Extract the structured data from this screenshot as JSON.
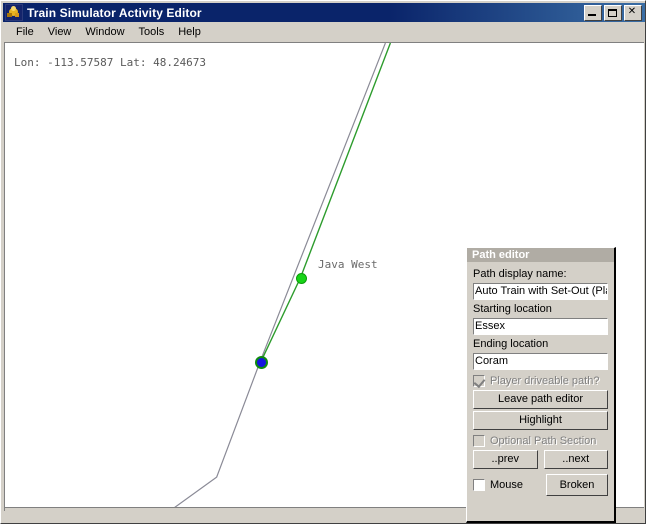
{
  "window": {
    "title": "Train Simulator Activity Editor",
    "icon": "app-icon",
    "controls": {
      "minimize": "minimize-icon",
      "maximize": "maximize-icon",
      "close": "✕"
    }
  },
  "menubar": {
    "items": [
      {
        "label": "File"
      },
      {
        "label": "View"
      },
      {
        "label": "Window"
      },
      {
        "label": "Tools"
      },
      {
        "label": "Help"
      }
    ]
  },
  "map": {
    "coordinates": "Lon: -113.57587 Lat: 48.24673",
    "markers": [
      {
        "name": "Java West",
        "type": "green-node",
        "label": "Java West"
      },
      {
        "name": "current-position",
        "type": "blue-node",
        "label": ""
      }
    ],
    "colors": {
      "track_line": "#8a8a96",
      "path_line": "#2d9c2d",
      "green_node": "#17d417",
      "blue_node": "#1515e0"
    }
  },
  "panel": {
    "title": "Path editor",
    "path_display_name_label": "Path display name:",
    "path_display_name_value": "Auto Train with Set-Out (Pla",
    "starting_location_label": "Starting location",
    "starting_location_value": "Essex",
    "ending_location_label": "Ending location",
    "ending_location_value": "Coram",
    "player_driveable_label": "Player driveable path?",
    "player_driveable_checked": true,
    "leave_button": "Leave path editor",
    "highlight_button": "Highlight",
    "optional_section_label": "Optional Path Section",
    "optional_section_checked": false,
    "prev_button": "..prev",
    "next_button": "..next",
    "mouse_label": "Mouse",
    "mouse_checked": false,
    "broken_button": "Broken"
  }
}
